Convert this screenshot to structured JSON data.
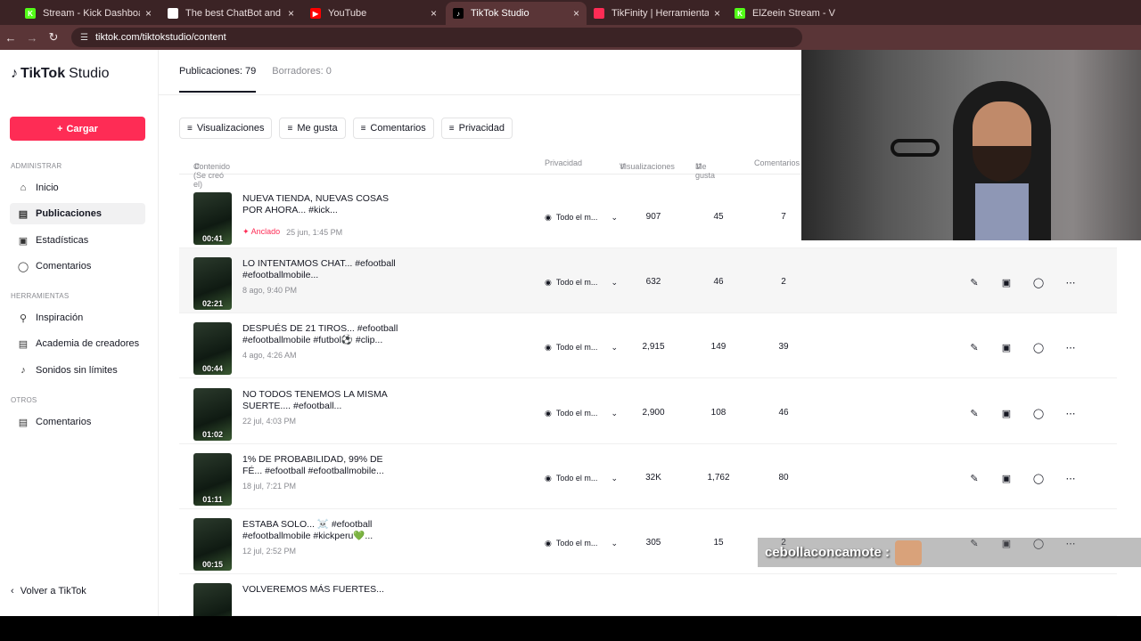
{
  "browser": {
    "tabs": [
      {
        "title": "Stream - Kick Dashboard",
        "fav_color": "#53fc18",
        "fav_letter": "K",
        "active": false
      },
      {
        "title": "The best ChatBot and Widgets",
        "fav_color": "#ffffff",
        "fav_letter": "",
        "active": false
      },
      {
        "title": "YouTube",
        "fav_color": "#ff0000",
        "fav_letter": "▶",
        "active": false
      },
      {
        "title": "TikTok Studio",
        "fav_color": "#000000",
        "fav_letter": "♪",
        "active": true
      },
      {
        "title": "TikFinity | Herramientas para Ti",
        "fav_color": "#fe2c55",
        "fav_letter": "",
        "active": false
      },
      {
        "title": "ElZeein Stream - V",
        "fav_color": "#53fc18",
        "fav_letter": "K",
        "active": false
      }
    ],
    "url": "tiktok.com/tiktokstudio/content"
  },
  "sidebar": {
    "logo": "TikTok",
    "logo_suffix": "Studio",
    "upload_label": "Cargar",
    "sections": {
      "admin": "ADMINISTRAR",
      "tools": "HERRAMIENTAS",
      "others": "OTROS"
    },
    "admin_items": [
      "Inicio",
      "Publicaciones",
      "Estadísticas",
      "Comentarios"
    ],
    "tool_items": [
      "Inspiración",
      "Academia de creadores",
      "Sonidos sin límites"
    ],
    "other_items": [
      "Comentarios"
    ],
    "back_label": "Volver a TikTok"
  },
  "content_tabs": {
    "published": "Publicaciones: 79",
    "drafts": "Borradores: 0"
  },
  "filters": [
    "Visualizaciones",
    "Me gusta",
    "Comentarios",
    "Privacidad"
  ],
  "table": {
    "headers": {
      "content": "Contenido (Se creó el)",
      "privacy": "Privacidad",
      "views": "Visualizaciones",
      "likes": "Me gusta",
      "comments": "Comentarios"
    },
    "rows": [
      {
        "title": "NUEVA TIENDA, NUEVAS COSAS POR AHORA... #kick...",
        "duration": "00:41",
        "pinned": "Anclado",
        "date": "25 jun, 1:45 PM",
        "privacy": "Todo el m...",
        "views": "907",
        "likes": "45",
        "comments": "7"
      },
      {
        "title": "LO INTENTAMOS CHAT... #efootball #efootballmobile...",
        "duration": "02:21",
        "pinned": "",
        "date": "8 ago, 9:40 PM",
        "privacy": "Todo el m...",
        "views": "632",
        "likes": "46",
        "comments": "2"
      },
      {
        "title": "DESPUÉS DE 21 TIROS... #efootball #efootballmobile #futbol⚽ #clip...",
        "duration": "00:44",
        "pinned": "",
        "date": "4 ago, 4:26 AM",
        "privacy": "Todo el m...",
        "views": "2,915",
        "likes": "149",
        "comments": "39"
      },
      {
        "title": "NO TODOS TENEMOS LA MISMA SUERTE.... #efootball...",
        "duration": "01:02",
        "pinned": "",
        "date": "22 jul, 4:03 PM",
        "privacy": "Todo el m...",
        "views": "2,900",
        "likes": "108",
        "comments": "46"
      },
      {
        "title": "1% DE PROBABILIDAD, 99% DE FÉ... #efootball #efootballmobile...",
        "duration": "01:11",
        "pinned": "",
        "date": "18 jul, 7:21 PM",
        "privacy": "Todo el m...",
        "views": "32K",
        "likes": "1,762",
        "comments": "80"
      },
      {
        "title": "ESTABA SOLO... ☠️ #efootball #efootballmobile #kickperu💚...",
        "duration": "00:15",
        "pinned": "",
        "date": "12 jul, 2:52 PM",
        "privacy": "Todo el m...",
        "views": "305",
        "likes": "15",
        "comments": "2"
      },
      {
        "title": "VOLVEREMOS MÁS FUERTES...",
        "duration": "",
        "pinned": "",
        "date": "",
        "privacy": "",
        "views": "",
        "likes": "",
        "comments": ""
      }
    ]
  },
  "overlay": {
    "chat_user": "cebollaconcamote :"
  }
}
